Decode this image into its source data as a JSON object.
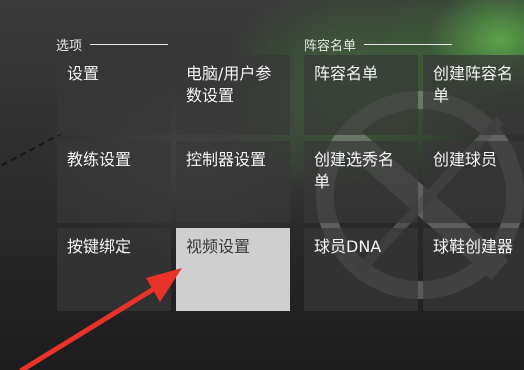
{
  "options": {
    "section_title": "选项",
    "tiles": [
      {
        "label": "设置"
      },
      {
        "label": "电脑/用户参数设置"
      },
      {
        "label": "教练设置"
      },
      {
        "label": "控制器设置"
      },
      {
        "label": "按键绑定"
      },
      {
        "label": "视频设置"
      }
    ]
  },
  "roster": {
    "section_title": "阵容名单",
    "tiles": [
      {
        "label": "阵容名单"
      },
      {
        "label": "创建阵容名单"
      },
      {
        "label": "创建选秀名单"
      },
      {
        "label": "创建球员"
      },
      {
        "label": "球员DNA"
      },
      {
        "label": "球鞋创建器"
      }
    ]
  },
  "colors": {
    "selected_tile": "#cfcfcf",
    "tile": "#373737",
    "arrow": "#e8322a",
    "glow": "#78ff5a"
  }
}
